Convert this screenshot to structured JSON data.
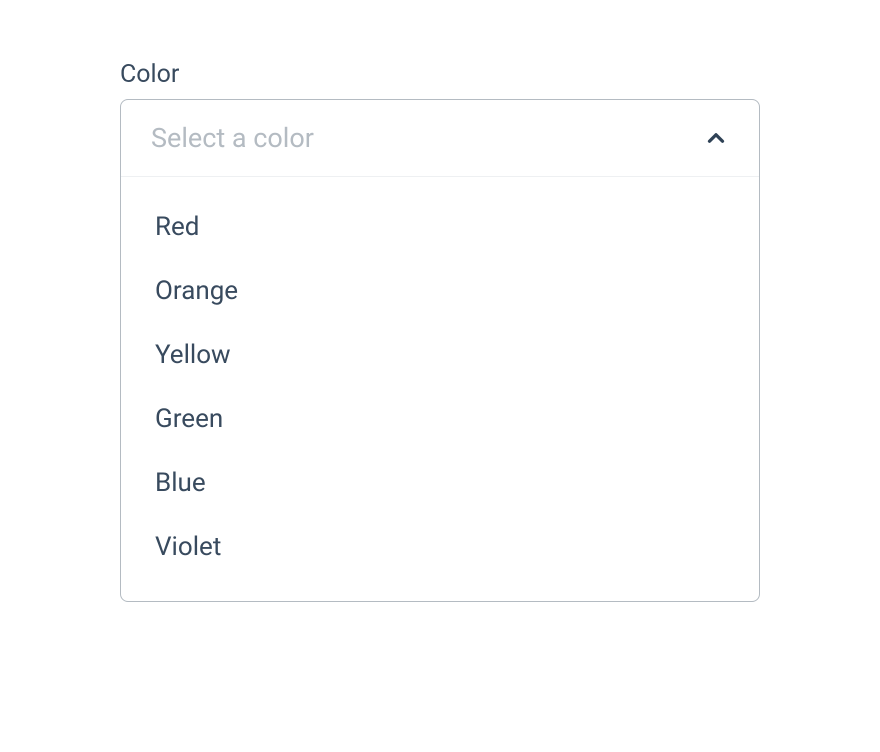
{
  "field": {
    "label": "Color",
    "placeholder": "Select a color"
  },
  "options": [
    {
      "label": "Red"
    },
    {
      "label": "Orange"
    },
    {
      "label": "Yellow"
    },
    {
      "label": "Green"
    },
    {
      "label": "Blue"
    },
    {
      "label": "Violet"
    }
  ]
}
